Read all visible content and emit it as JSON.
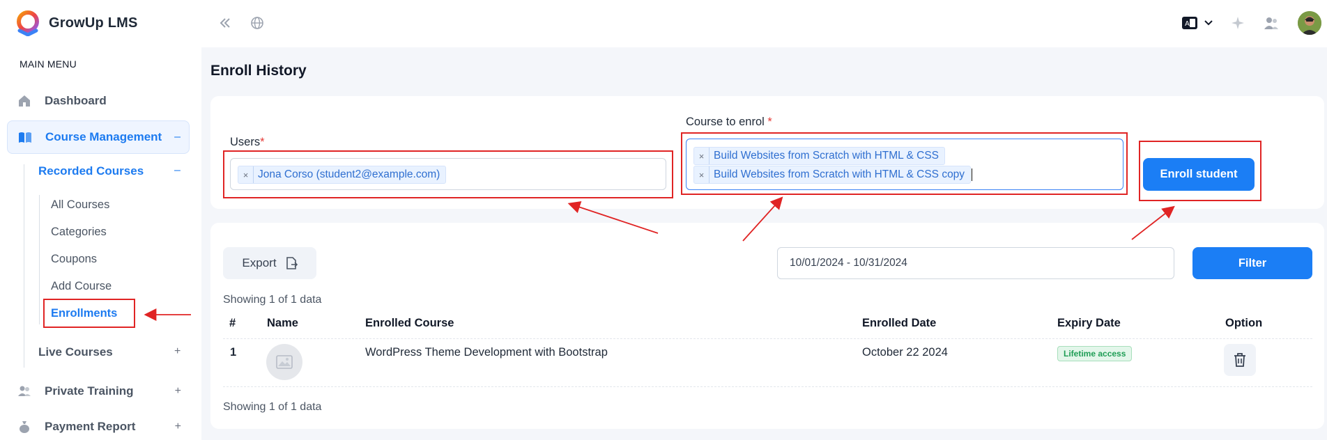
{
  "brand": {
    "name": "GrowUp LMS"
  },
  "sidebar": {
    "menu_title": "MAIN MENU",
    "items": [
      {
        "label": "Dashboard",
        "icon": "home-icon"
      },
      {
        "label": "Course Management",
        "icon": "book-icon",
        "sign": "–",
        "active": true
      },
      {
        "label": "Private Training",
        "icon": "users-icon",
        "sign": "+"
      },
      {
        "label": "Payment Report",
        "icon": "money-bag-icon",
        "sign": "+"
      }
    ],
    "sub": {
      "recorded": {
        "label": "Recorded Courses",
        "sign": "–"
      },
      "live": {
        "label": "Live Courses",
        "sign": "+"
      },
      "leaves": [
        "All Courses",
        "Categories",
        "Coupons",
        "Add Course",
        "Enrollments"
      ]
    }
  },
  "header": {
    "icons": [
      "collapse-sidebar-icon",
      "globe-icon",
      "language-icon",
      "chevron-down-icon",
      "sparkle-icon",
      "users-icon",
      "avatar"
    ]
  },
  "page": {
    "title": "Enroll History"
  },
  "enroll_form": {
    "users_label": "Users",
    "required_mark": "*",
    "users_selected": [
      "Jona Corso (student2@example.com)"
    ],
    "course_label": "Course to enrol",
    "courses_selected": [
      "Build Websites from Scratch with HTML & CSS",
      "Build Websites from Scratch with HTML & CSS copy"
    ],
    "chip_remove": "×",
    "submit_label": "Enroll student"
  },
  "toolbar": {
    "export_label": "Export",
    "date_range": "10/01/2024 - 10/31/2024",
    "filter_label": "Filter"
  },
  "table": {
    "showing_top": "Showing 1 of 1 data",
    "showing_bottom": "Showing 1 of 1 data",
    "columns": [
      "#",
      "Name",
      "Enrolled Course",
      "Enrolled Date",
      "Expiry Date",
      "Option"
    ],
    "rows": [
      {
        "index": "1",
        "course": "WordPress Theme Development with Bootstrap",
        "enrolled_date": "October 22 2024",
        "expiry": "Lifetime access"
      }
    ]
  },
  "colors": {
    "accent": "#1b7ef5",
    "annotation": "#e02424",
    "success": "#1f9d55"
  }
}
